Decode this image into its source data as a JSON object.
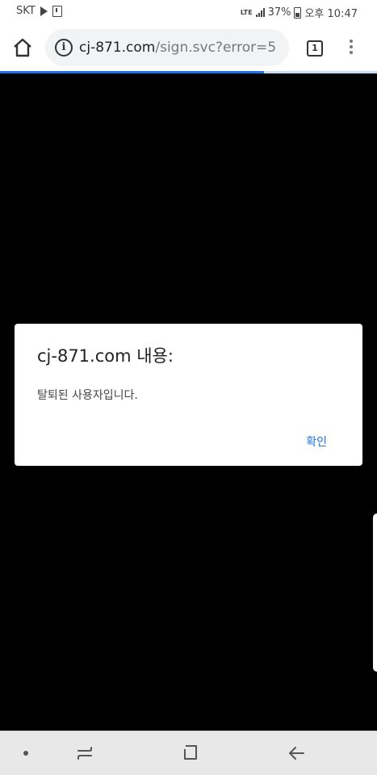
{
  "status_bar": {
    "carrier": "SKT",
    "network": "LTE",
    "battery": "37%",
    "time": "오후 10:47"
  },
  "browser": {
    "url_domain": "cj-871.com",
    "url_path": "/sign.svc?error=5",
    "tab_count": "1",
    "load_progress": 0.7,
    "accent_color": "#1a73e8"
  },
  "dialog": {
    "title": "cj-871.com 내용:",
    "message": "탈퇴된 사용자입니다.",
    "ok_label": "확인"
  },
  "icons": {
    "home": "home-icon",
    "info": "info-icon",
    "menu": "more-vert-icon",
    "nav_recent": "recent-apps-icon",
    "nav_home": "home-button-icon",
    "nav_back": "back-icon"
  }
}
